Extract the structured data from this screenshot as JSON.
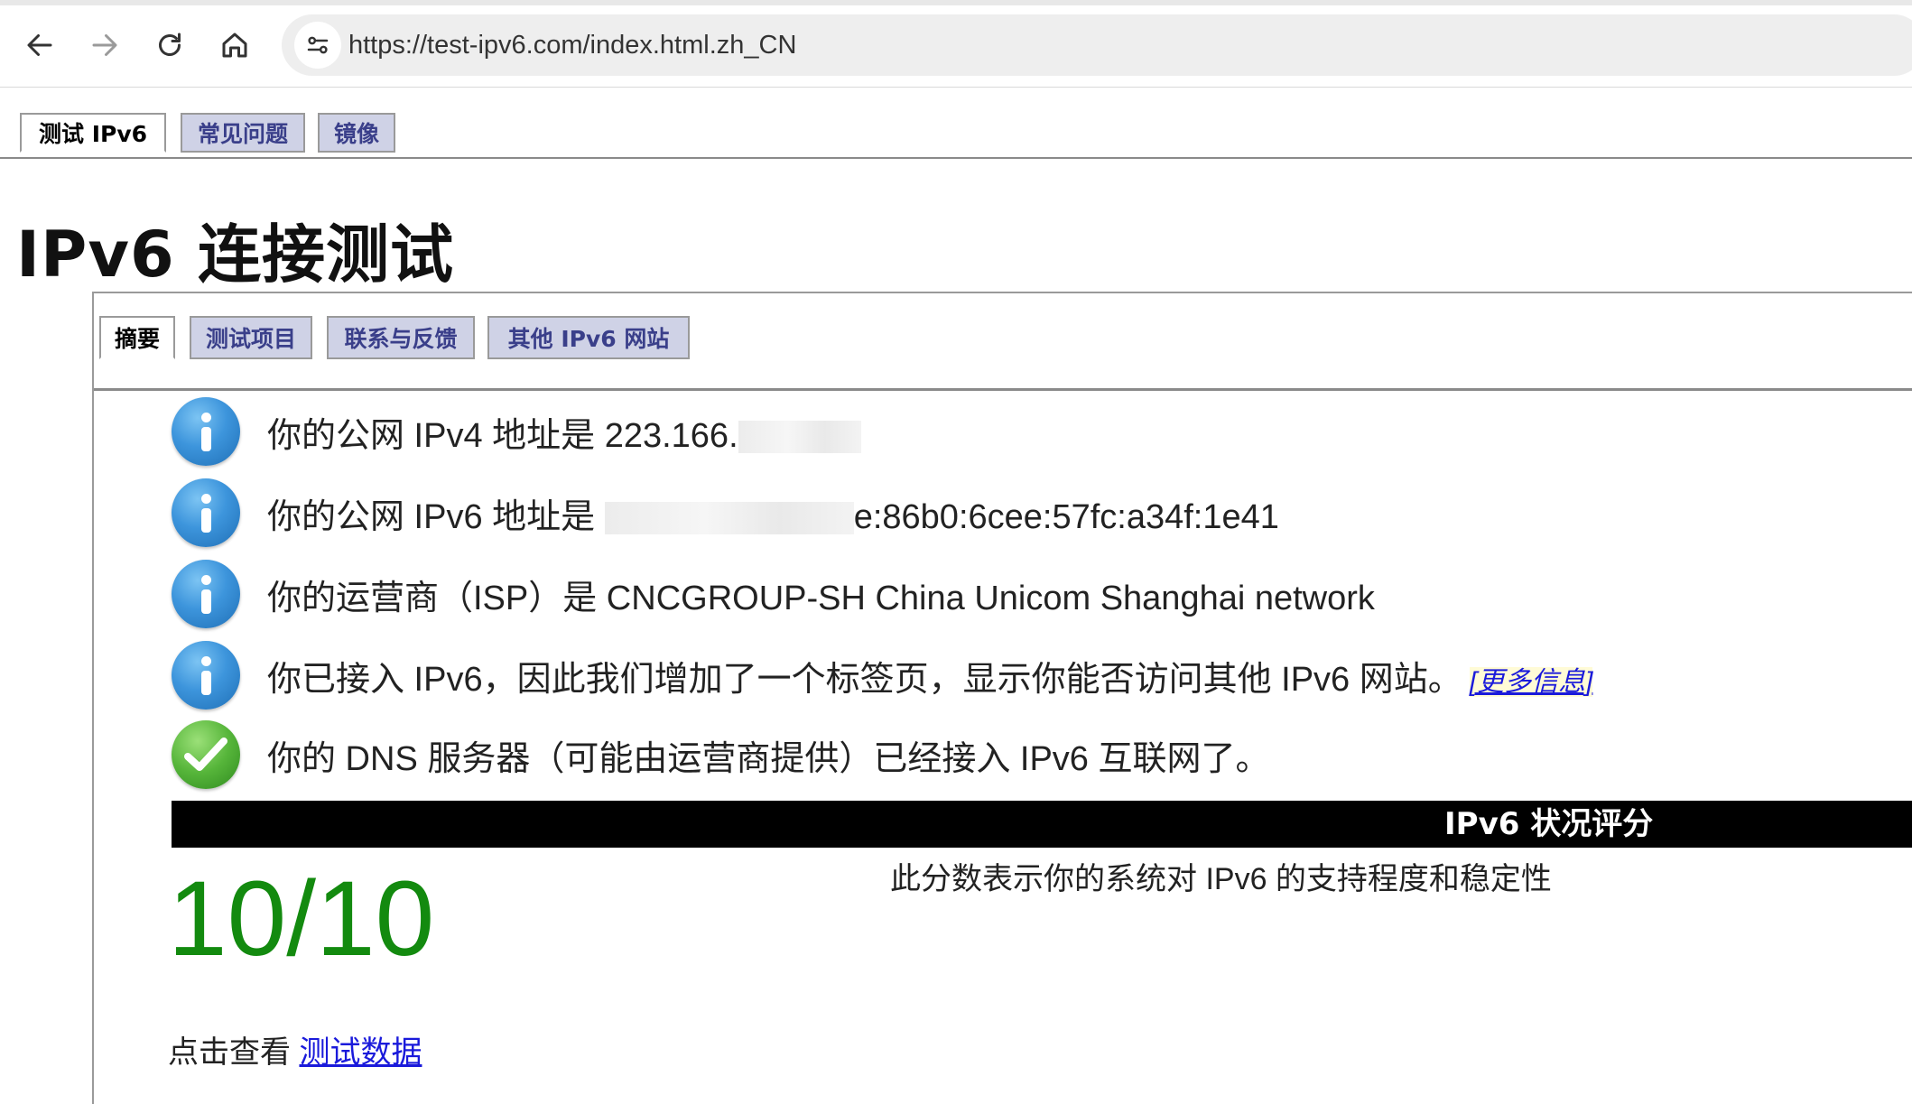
{
  "browser": {
    "url": "https://test-ipv6.com/index.html.zh_CN",
    "nav": [
      "back-arrow-icon",
      "forward-arrow-icon",
      "reload-icon",
      "home-icon"
    ]
  },
  "top_tabs": [
    {
      "label": "测试 IPv6",
      "active": true
    },
    {
      "label": "常见问题",
      "active": false
    },
    {
      "label": "镜像",
      "active": false
    }
  ],
  "page_title": "IPv6 连接测试",
  "sub_tabs": [
    {
      "label": "摘要",
      "active": true
    },
    {
      "label": "测试项目",
      "active": false
    },
    {
      "label": "联系与反馈",
      "active": false
    },
    {
      "label": "其他 IPv6 网站",
      "active": false
    }
  ],
  "results": [
    {
      "icon": "info-icon",
      "text": "你的公网 IPv4 地址是 223.166.",
      "redacted_suffix": true
    },
    {
      "icon": "info-icon",
      "prefix": "你的公网 IPv6 地址是 ",
      "suffix": "e:86b0:6cee:57fc:a34f:1e41",
      "redacted_middle": true
    },
    {
      "icon": "info-icon",
      "text": "你的运营商（ISP）是 CNCGROUP-SH China Unicom Shanghai network"
    },
    {
      "icon": "info-icon",
      "text": "你已接入 IPv6，因此我们增加了一个标签页，显示你能否访问其他 IPv6 网站。",
      "link": "[更多信息]"
    },
    {
      "icon": "check-icon",
      "text": "你的 DNS 服务器（可能由运营商提供）已经接入 IPv6 互联网了。"
    }
  ],
  "score": {
    "header": "IPv6 状况评分",
    "value": "10/10",
    "description": "此分数表示你的系统对 IPv6 的支持程度和稳定性",
    "color": "#138a0f"
  },
  "footer": {
    "prefix": "点击查看 ",
    "link": "测试数据"
  }
}
